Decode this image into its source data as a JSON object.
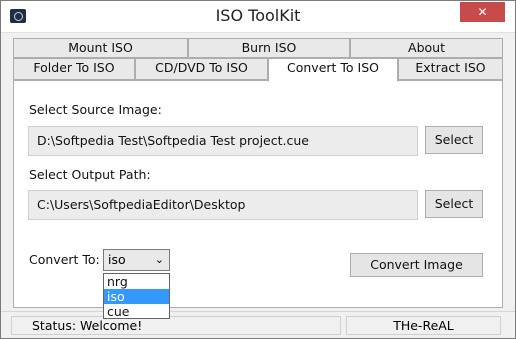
{
  "window": {
    "title": "ISO ToolKit",
    "close_glyph": "✕"
  },
  "tabs_row1": [
    {
      "label": "Mount ISO"
    },
    {
      "label": "Burn ISO"
    },
    {
      "label": "About"
    }
  ],
  "tabs_row2": [
    {
      "label": "Folder To ISO"
    },
    {
      "label": "CD/DVD To ISO"
    },
    {
      "label": "Convert To ISO",
      "active": true
    },
    {
      "label": "Extract ISO"
    }
  ],
  "source": {
    "label": "Select Source Image:",
    "value": "D:\\Softpedia Test\\Softpedia Test project.cue",
    "button": "Select"
  },
  "output": {
    "label": "Select Output Path:",
    "value": "C:\\Users\\SoftpediaEditor\\Desktop",
    "button": "Select"
  },
  "convert": {
    "label": "Convert To:",
    "selected": "iso",
    "options": [
      "nrg",
      "iso",
      "cue"
    ],
    "button": "Convert Image"
  },
  "status": {
    "text": "Status: Welcome!",
    "author": "THe-ReAL"
  },
  "colors": {
    "accent": "#3399ff",
    "close": "#c74b4b"
  }
}
